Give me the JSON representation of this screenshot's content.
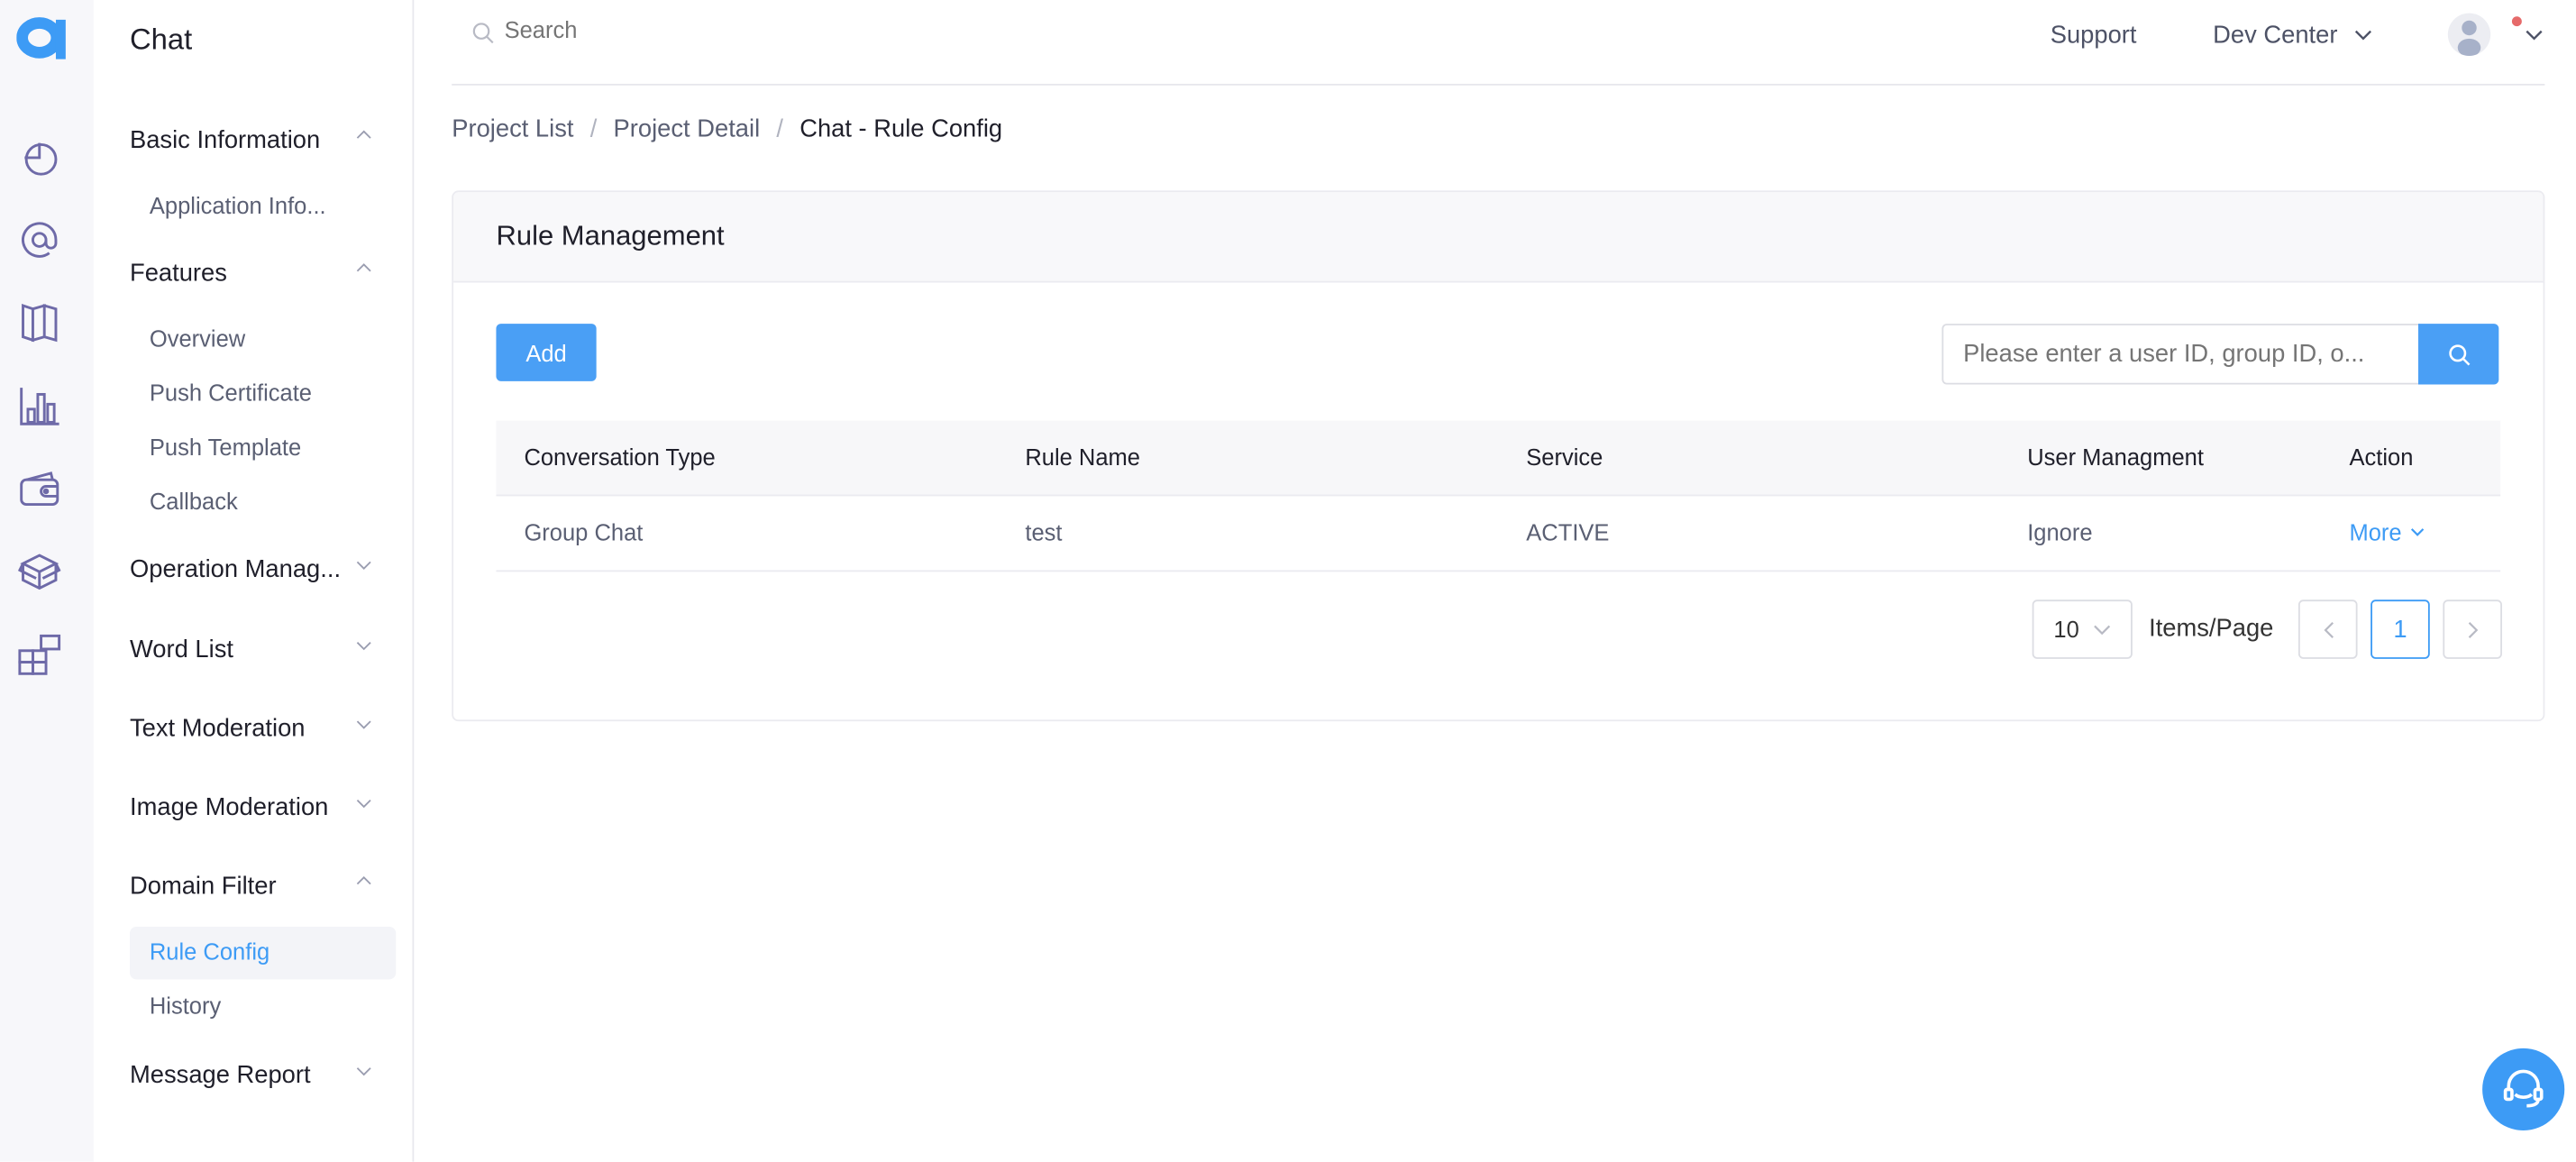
{
  "app": {
    "title": "Chat",
    "accent": "#3d9bf5"
  },
  "rail_icons": [
    "dashboard-icon",
    "at-icon",
    "map-icon",
    "bar-chart-icon",
    "wallet-icon",
    "box-icon",
    "apps-icon"
  ],
  "sidebar": {
    "groups": [
      {
        "label": "Basic Information",
        "expanded": true,
        "items": [
          "Application Info..."
        ]
      },
      {
        "label": "Features",
        "expanded": true,
        "items": [
          "Overview",
          "Push Certificate",
          "Push Template",
          "Callback"
        ]
      },
      {
        "label": "Operation Manag...",
        "expanded": false,
        "items": []
      },
      {
        "label": "Word List",
        "expanded": false,
        "items": []
      },
      {
        "label": "Text Moderation",
        "expanded": false,
        "items": []
      },
      {
        "label": "Image Moderation",
        "expanded": false,
        "items": []
      },
      {
        "label": "Domain Filter",
        "expanded": true,
        "items": [
          "Rule Config",
          "History"
        ],
        "active": "Rule Config"
      },
      {
        "label": "Message Report",
        "expanded": false,
        "items": []
      }
    ]
  },
  "header": {
    "search_placeholder": "Search",
    "support": "Support",
    "dev_center": "Dev Center"
  },
  "breadcrumb": [
    "Project List",
    "Project Detail",
    "Chat - Rule Config"
  ],
  "card": {
    "title": "Rule Management",
    "add_label": "Add",
    "search_placeholder": "Please enter a user ID, group ID, o...",
    "columns": [
      "Conversation Type",
      "Rule Name",
      "Service",
      "User Managment",
      "Action"
    ],
    "rows": [
      {
        "type": "Group Chat",
        "name": "test",
        "service": "ACTIVE",
        "user": "Ignore",
        "action": "More"
      }
    ],
    "pagination": {
      "page_size": "10",
      "items_label": "Items/Page",
      "current_page": "1"
    }
  }
}
